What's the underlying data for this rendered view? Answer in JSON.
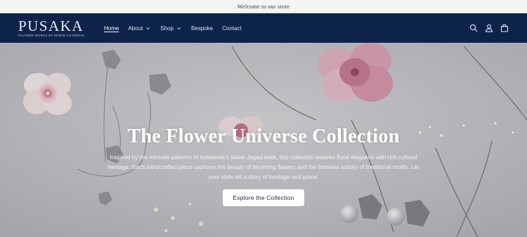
{
  "announcement": {
    "text": "Welcome to our store"
  },
  "header": {
    "logo_text": "PUSAKA",
    "logo_subtitle": "FILIGREE WORKS BY EDWIN CHARMAIN",
    "nav": [
      {
        "label": "Home",
        "active": true,
        "dropdown": false
      },
      {
        "label": "About",
        "active": false,
        "dropdown": true
      },
      {
        "label": "Shop",
        "active": false,
        "dropdown": true
      },
      {
        "label": "Bespoke",
        "active": false,
        "dropdown": false
      },
      {
        "label": "Contact",
        "active": false,
        "dropdown": false
      }
    ],
    "icons": [
      "search-icon",
      "account-icon",
      "cart-icon"
    ],
    "background": "#0d234a"
  },
  "hero": {
    "title": "The Flower Universe Collection",
    "description": "Inspired by the intricate patterns of Indonesia's Sekar Jagad batik, this collection weaves floral elegance with rich cultural heritage. Each handcrafted piece captures the beauty of blooming flowers and the timeless artistry of traditional motifs. Let your style tell a story of heritage and grace.",
    "button_label": "Explore the Collection"
  }
}
